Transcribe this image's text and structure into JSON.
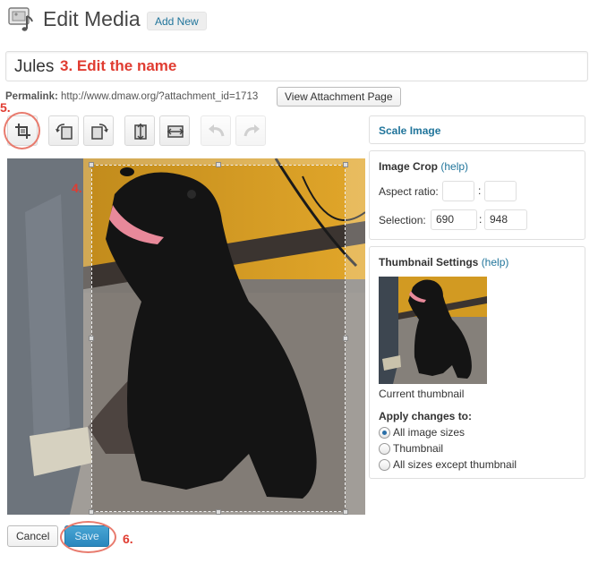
{
  "header": {
    "icon": "media-icon",
    "title": "Edit Media",
    "add_new_label": "Add New"
  },
  "title_field": {
    "value": "Jules",
    "annotation": "3. Edit the name"
  },
  "permalink": {
    "label": "Permalink:",
    "url": "http://www.dmaw.org/?attachment_id=1713",
    "view_button_label": "View Attachment Page"
  },
  "toolbar": {
    "tools": [
      {
        "name": "crop-icon",
        "enabled": true
      },
      {
        "name": "rotate-left-icon",
        "enabled": true
      },
      {
        "name": "rotate-right-icon",
        "enabled": true
      },
      {
        "name": "flip-vertical-icon",
        "enabled": true
      },
      {
        "name": "flip-horizontal-icon",
        "enabled": true
      },
      {
        "name": "undo-icon",
        "enabled": false
      },
      {
        "name": "redo-icon",
        "enabled": false
      }
    ],
    "annotation": "5."
  },
  "image": {
    "annotation": "4."
  },
  "sidebar": {
    "scale_image_label": "Scale Image",
    "image_crop": {
      "title": "Image Crop",
      "help_label": "(help)",
      "aspect_label": "Aspect ratio:",
      "aspect_w": "",
      "aspect_h": "",
      "colon": ":",
      "selection_label": "Selection:",
      "selection_w": "690",
      "selection_h": "948"
    },
    "thumbnail": {
      "title": "Thumbnail Settings",
      "help_label": "(help)",
      "caption": "Current thumbnail",
      "apply_label": "Apply changes to:",
      "options": [
        "All image sizes",
        "Thumbnail",
        "All sizes except thumbnail"
      ],
      "selected_index": 0
    }
  },
  "footer": {
    "cancel_label": "Cancel",
    "save_label": "Save",
    "annotation": "6."
  },
  "colors": {
    "link": "#21759b",
    "annotation_red": "#e03c31",
    "highlight_ring": "#e87b6e",
    "save_button": "#2a87be"
  }
}
